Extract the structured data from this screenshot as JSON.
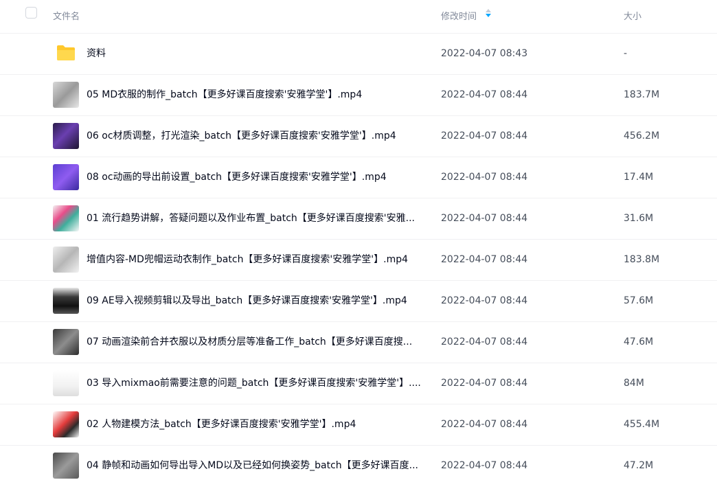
{
  "header": {
    "name_label": "文件名",
    "time_label": "修改时间",
    "size_label": "大小",
    "accent_color": "#06a7ff"
  },
  "files": [
    {
      "name": "资料",
      "time": "2022-04-07 08:43",
      "size": "-",
      "icon": "folder-icon",
      "thumb": ""
    },
    {
      "name": "05 MD衣服的制作_batch【更多好课百度搜索'安雅学堂'】.mp4",
      "time": "2022-04-07 08:44",
      "size": "183.7M",
      "icon": "video-thumbnail",
      "thumb": "t-gray"
    },
    {
      "name": "06 oc材质调整，打光渲染_batch【更多好课百度搜索'安雅学堂'】.mp4",
      "time": "2022-04-07 08:44",
      "size": "456.2M",
      "icon": "video-thumbnail",
      "thumb": "t-dark-purple"
    },
    {
      "name": "08 oc动画的导出前设置_batch【更多好课百度搜索'安雅学堂'】.mp4",
      "time": "2022-04-07 08:44",
      "size": "17.4M",
      "icon": "video-thumbnail",
      "thumb": "t-purple"
    },
    {
      "name": "01 流行趋势讲解，答疑问题以及作业布置_batch【更多好课百度搜索'安雅...",
      "time": "2022-04-07 08:44",
      "size": "31.6M",
      "icon": "video-thumbnail",
      "thumb": "t-white-mixed"
    },
    {
      "name": "增值内容-MD兜帽运动衣制作_batch【更多好课百度搜索'安雅学堂'】.mp4",
      "time": "2022-04-07 08:44",
      "size": "183.8M",
      "icon": "video-thumbnail",
      "thumb": "t-lightgray"
    },
    {
      "name": "09 AE导入视频剪辑以及导出_batch【更多好课百度搜索'安雅学堂'】.mp4",
      "time": "2022-04-07 08:44",
      "size": "57.6M",
      "icon": "video-thumbnail",
      "thumb": "t-black"
    },
    {
      "name": "07 动画渲染前合并衣服以及材质分层等准备工作_batch【更多好课百度搜...",
      "time": "2022-04-07 08:44",
      "size": "47.6M",
      "icon": "video-thumbnail",
      "thumb": "t-dark-gray"
    },
    {
      "name": "03 导入mixmao前需要注意的问题_batch【更多好课百度搜索'安雅学堂'】....",
      "time": "2022-04-07 08:44",
      "size": "84M",
      "icon": "video-thumbnail",
      "thumb": "t-white-ui"
    },
    {
      "name": "02 人物建模方法_batch【更多好课百度搜索'安雅学堂'】.mp4",
      "time": "2022-04-07 08:44",
      "size": "455.4M",
      "icon": "video-thumbnail",
      "thumb": "t-red-figs"
    },
    {
      "name": "04 静帧和动画如何导出导入MD以及已经如何换姿势_batch【更多好课百度...",
      "time": "2022-04-07 08:44",
      "size": "47.2M",
      "icon": "video-thumbnail",
      "thumb": "t-gray-figure"
    }
  ]
}
